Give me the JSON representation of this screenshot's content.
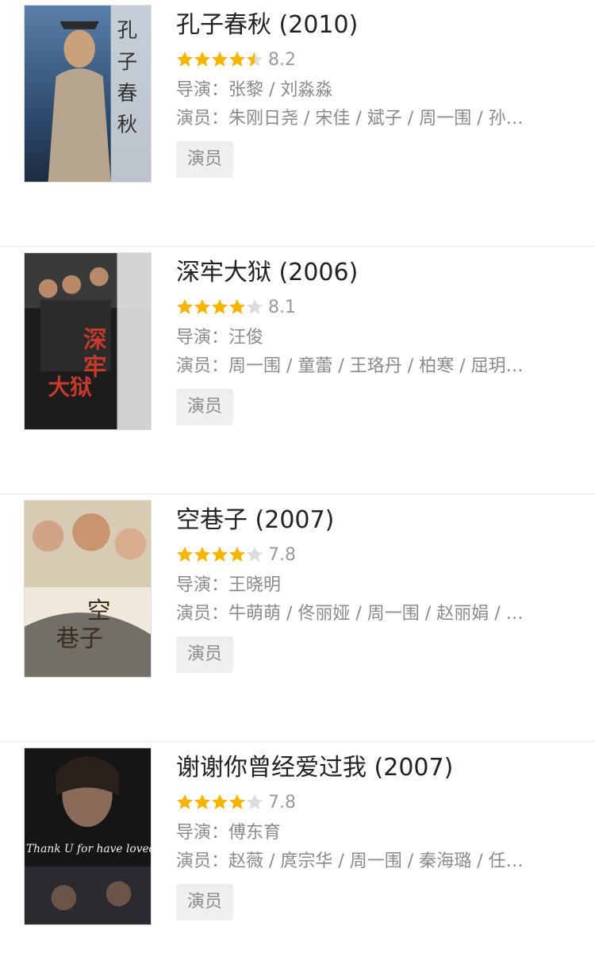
{
  "items": [
    {
      "title": "孔子春秋 (2010)",
      "rating_score": "8.2",
      "rating_stars": 4.5,
      "director": "导演：张黎 / 刘淼淼",
      "actors": "演员：朱刚日尧 / 宋佳 / 斌子 / 周一围 / 孙…",
      "tag": "演员",
      "poster_text": "孔子春秋"
    },
    {
      "title": "深牢大狱 (2006)",
      "rating_score": "8.1",
      "rating_stars": 4,
      "director": "导演：汪俊",
      "actors": "演员：周一围 / 童蕾 / 王珞丹 / 柏寒 / 屈玥…",
      "tag": "演员",
      "poster_text": "深牢大狱"
    },
    {
      "title": "空巷子 (2007)",
      "rating_score": "7.8",
      "rating_stars": 4,
      "director": "导演：王晓明",
      "actors": "演员：牛萌萌 / 佟丽娅 / 周一围 / 赵丽娟 / …",
      "tag": "演员",
      "poster_text": "空巷子"
    },
    {
      "title": "谢谢你曾经爱过我 (2007)",
      "rating_score": "7.8",
      "rating_stars": 4,
      "director": "导演：傅东育",
      "actors": "演员：赵薇 / 庹宗华 / 周一围 / 秦海璐 / 任…",
      "tag": "演员",
      "poster_text": "Thank U for have loved m"
    }
  ],
  "colors": {
    "star_filled": "#f7b500",
    "star_empty": "#dcdcdc"
  },
  "icons": {
    "star": "star-icon"
  }
}
